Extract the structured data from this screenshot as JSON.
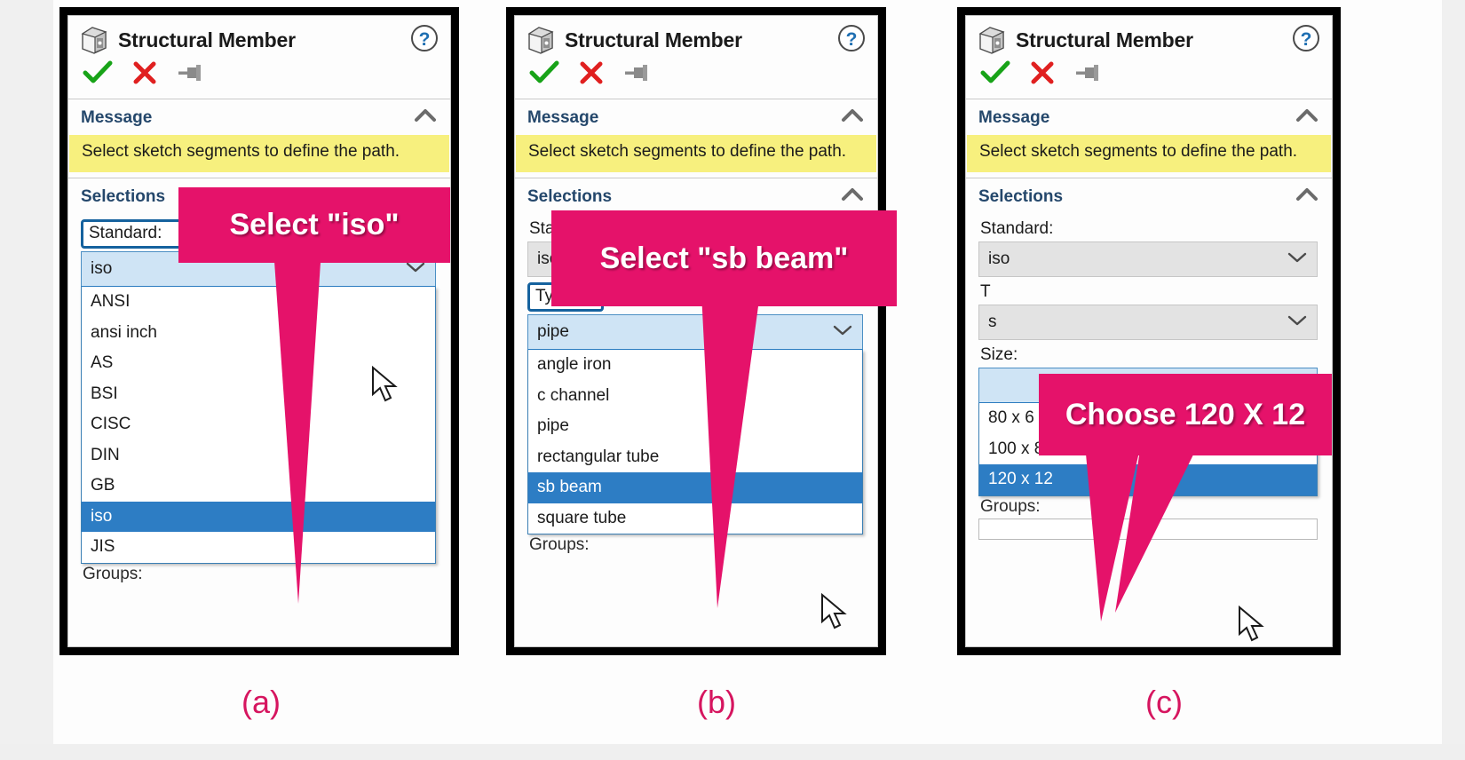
{
  "theme": {
    "callout_pink": "#e5126a",
    "caption_pink": "#d6155f",
    "message_yellow": "#f7f07e",
    "selected_blue": "#2d7dc4",
    "highlight_blue": "#cfe4f5",
    "outline_blue": "#15629e",
    "section_text": "#24476b"
  },
  "panels": [
    {
      "caption": "(a)",
      "title": "Structural Member",
      "icon": "structural-member-cube-icon",
      "toolbar": {
        "ok": "ok-checkmark-icon",
        "cancel": "cancel-x-icon",
        "pin": "pin-icon",
        "help": "help-question-icon"
      },
      "message_section": {
        "title": "Message",
        "collapse": "chevron-up-icon",
        "text": "Select sketch segments to define the path."
      },
      "selections_section": {
        "title": "Selections",
        "collapse": "chevron-up-icon"
      },
      "standard": {
        "label": "Standard:",
        "value": "iso",
        "boxed": true,
        "open": true,
        "options": [
          "ANSI",
          "ansi inch",
          "AS",
          "BSI",
          "CISC",
          "DIN",
          "GB",
          "iso",
          "JIS"
        ],
        "selected": "iso"
      },
      "groups_label": "Groups:",
      "callout": {
        "text": "Select \"iso\"",
        "font_size": 34
      }
    },
    {
      "caption": "(b)",
      "title": "Structural Member",
      "icon": "structural-member-cube-icon",
      "toolbar": {
        "ok": "ok-checkmark-icon",
        "cancel": "cancel-x-icon",
        "pin": "pin-icon",
        "help": "help-question-icon"
      },
      "message_section": {
        "title": "Message",
        "collapse": "chevron-up-icon",
        "text": "Select sketch segments to define the path."
      },
      "selections_section": {
        "title": "Selections",
        "collapse": "chevron-up-icon"
      },
      "standard": {
        "label": "Standard:",
        "value": "iso",
        "boxed": false,
        "open": false
      },
      "type": {
        "label": "Type:",
        "value": "pipe",
        "boxed": true,
        "open": true,
        "options": [
          "angle iron",
          "c channel",
          "pipe",
          "rectangular tube",
          "sb beam",
          "square tube"
        ],
        "selected": "sb beam"
      },
      "groups_label": "Groups:",
      "callout": {
        "text": "Select \"sb beam\"",
        "font_size": 34
      }
    },
    {
      "caption": "(c)",
      "title": "Structural Member",
      "icon": "structural-member-cube-icon",
      "toolbar": {
        "ok": "ok-checkmark-icon",
        "cancel": "cancel-x-icon",
        "pin": "pin-icon",
        "help": "help-question-icon"
      },
      "message_section": {
        "title": "Message",
        "collapse": "chevron-up-icon",
        "text": "Select sketch segments to define the path."
      },
      "selections_section": {
        "title": "Selections",
        "collapse": "chevron-up-icon"
      },
      "standard": {
        "label": "Standard:",
        "value": "iso",
        "boxed": false,
        "open": false
      },
      "type": {
        "label": "T",
        "value": "s",
        "boxed": false,
        "open": false
      },
      "size": {
        "label": "Size:",
        "value": "",
        "open": true,
        "options": [
          "80 x 6",
          "100 x 8",
          "120 x 12"
        ],
        "selected": "120 x 12"
      },
      "groups_label": "Groups:",
      "callout": {
        "text": "Choose 120 X 12",
        "font_size": 34
      }
    }
  ]
}
